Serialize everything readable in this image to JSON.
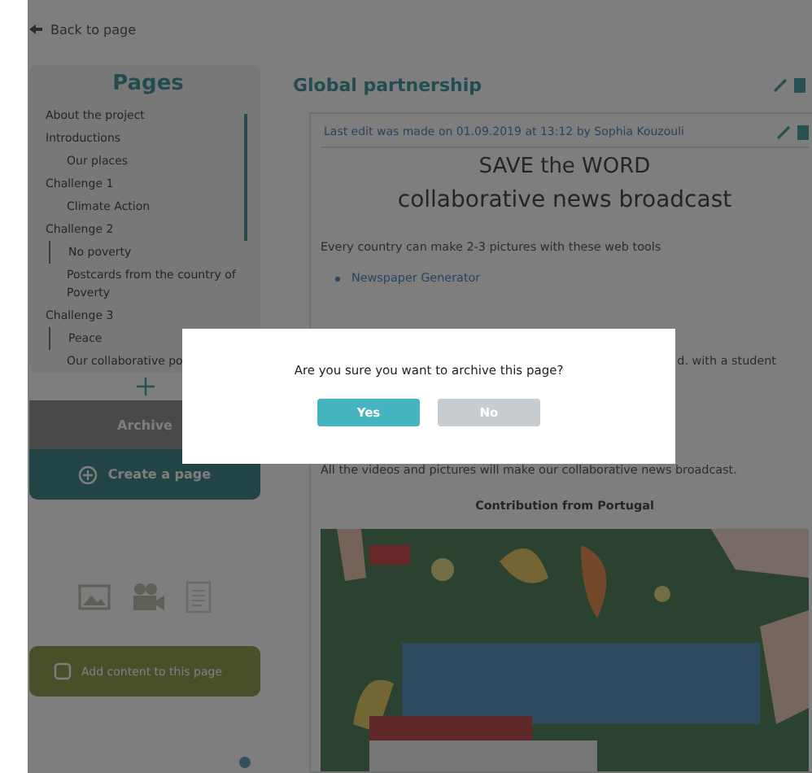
{
  "back_link": "Back to page",
  "sidebar": {
    "title": "Pages",
    "items": [
      {
        "label": "About the project"
      },
      {
        "label": "Introductions",
        "children": [
          {
            "label": "Our places"
          }
        ]
      },
      {
        "label": "Challenge 1",
        "children": [
          {
            "label": "Climate Action"
          }
        ]
      },
      {
        "label": "Challenge 2",
        "children": [
          {
            "label": "No poverty"
          },
          {
            "label": "Postcards from the country of Poverty"
          }
        ]
      },
      {
        "label": "Challenge 3",
        "children": [
          {
            "label": "Peace"
          },
          {
            "label": "Our collaborative po"
          }
        ]
      }
    ],
    "archive_button": "Archive",
    "create_button": "Create a page",
    "add_content_button": "Add content to this page"
  },
  "page": {
    "title": "Global partnership",
    "last_edit": "Last edit was made on 01.09.2019 at 13:12 by Sophia Kouzouli",
    "heading": [
      "SAVE the WORD",
      "collaborative news broadcast"
    ],
    "intro": "Every country can make 2-3 pictures with these web tools",
    "links": [
      "Newspaper Generator"
    ],
    "partial_line": "d. with a student",
    "closing": "All the videos and pictures will make our collaborative news broadcast.",
    "contribution": "Contribution from Portugal",
    "image": {
      "kind": "picture"
    }
  },
  "dialog": {
    "message": "Are you sure you want to archive this page?",
    "buttons": [
      {
        "label": "Yes",
        "kind": "confirm"
      },
      {
        "label": "No",
        "kind": "cancel"
      }
    ]
  }
}
